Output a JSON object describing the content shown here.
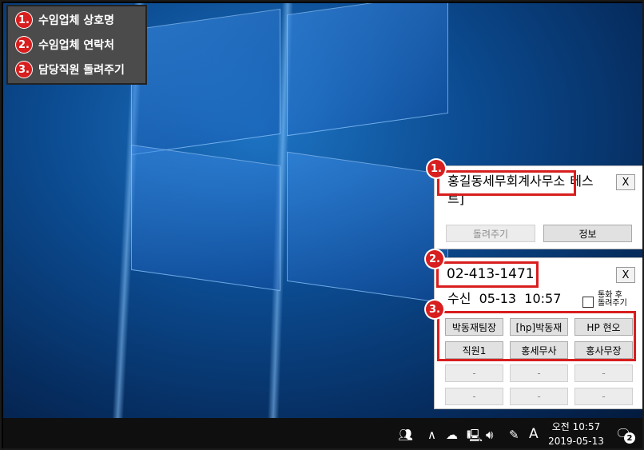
{
  "legend": {
    "items": [
      {
        "num": "1.",
        "text": "수임업체 상호명"
      },
      {
        "num": "2.",
        "text": "수임업체 연락처"
      },
      {
        "num": "3.",
        "text": "담당직원 돌려주기"
      }
    ]
  },
  "popup1": {
    "badge": "1.",
    "company_name": "홍길동세무회계사무소",
    "suffix": "테스",
    "suffix_line2": "트]",
    "close": "X",
    "forward_button": "돌려주기",
    "info_button": "정보"
  },
  "popup2": {
    "badge": "2.",
    "phone": "02-413-1471",
    "received": "수신  05-13  10:57",
    "close": "X",
    "checkbox_label_line1": "통화 후",
    "checkbox_label_line2": "돌려주기",
    "staff_badge": "3.",
    "staff_buttons": [
      "박동재팀장",
      "[hp]박동재",
      "HP 현오",
      "직원1",
      "홍세무사",
      "홍사무장"
    ],
    "empty_buttons": [
      "-",
      "-",
      "-",
      "-",
      "-",
      "-"
    ]
  },
  "taskbar": {
    "time": "오전 10:57",
    "date": "2019-05-13",
    "ime": "A",
    "notification_count": "2"
  }
}
